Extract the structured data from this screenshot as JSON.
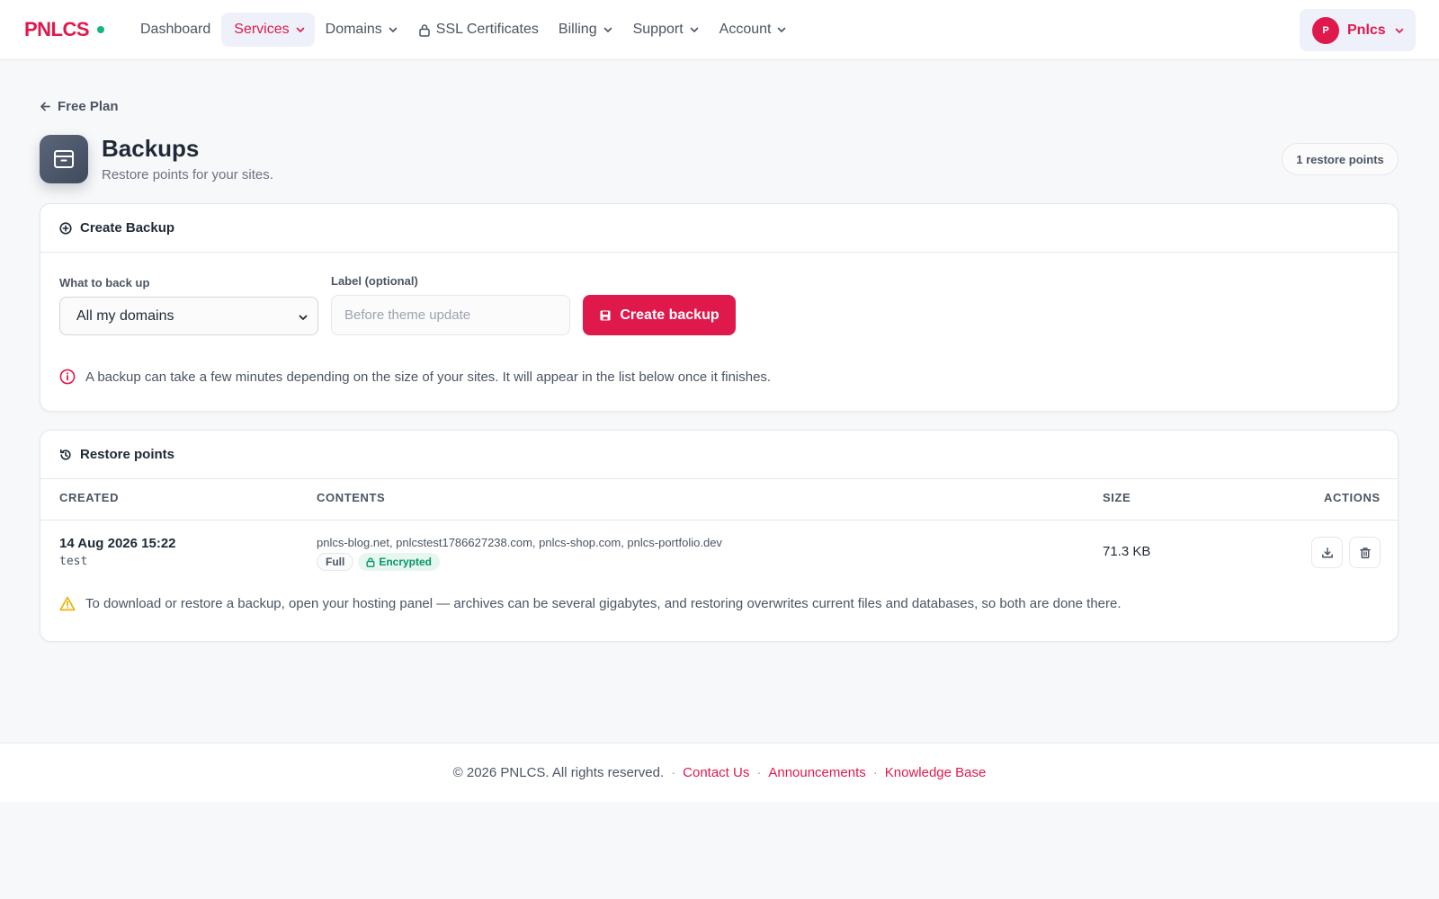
{
  "brand": {
    "name": "PNLCS",
    "status_color": "#10b981",
    "accent_color": "#e0194d"
  },
  "nav": {
    "items": [
      {
        "label": "Dashboard",
        "active": false,
        "has_dropdown": false
      },
      {
        "label": "Services",
        "active": true,
        "has_dropdown": true
      },
      {
        "label": "Domains",
        "active": false,
        "has_dropdown": true
      },
      {
        "label": "SSL Certificates",
        "active": false,
        "has_dropdown": false,
        "icon": "lock-icon"
      },
      {
        "label": "Billing",
        "active": false,
        "has_dropdown": true
      },
      {
        "label": "Support",
        "active": false,
        "has_dropdown": true
      },
      {
        "label": "Account",
        "active": false,
        "has_dropdown": true
      }
    ],
    "user": {
      "initial": "P",
      "name": "Pnlcs"
    }
  },
  "page": {
    "back_label": "Free Plan",
    "title": "Backups",
    "subtitle": "Restore points for your sites.",
    "count_label": "1 restore points",
    "icon": "archive-icon"
  },
  "create_backup": {
    "title": "Create Backup",
    "what_label": "What to back up",
    "what_value": "All my domains",
    "label_label": "Label (optional)",
    "label_placeholder": "Before theme update",
    "button_label": "Create backup",
    "info_text": "A backup can take a few minutes depending on the size of your sites. It will appear in the list below once it finishes."
  },
  "restore_points": {
    "title": "Restore points",
    "columns": [
      "CREATED",
      "CONTENTS",
      "SIZE",
      "ACTIONS"
    ],
    "rows": [
      {
        "created": "14 Aug 2026 15:22",
        "label": "test",
        "contents": "pnlcs-blog.net, pnlcstest1786627238.com, pnlcs-shop.com, pnlcs-portfolio.dev",
        "type_badge": "Full",
        "encryption_badge": "Encrypted",
        "size": "71.3 KB"
      }
    ],
    "warning_text": "To download or restore a backup, open your hosting panel — archives can be several gigabytes, and restoring overwrites current files and databases, so both are done there."
  },
  "footer": {
    "copyright": "© 2026 PNLCS. All rights reserved.",
    "separator": "·",
    "links": [
      "Contact Us",
      "Announcements",
      "Knowledge Base"
    ]
  }
}
